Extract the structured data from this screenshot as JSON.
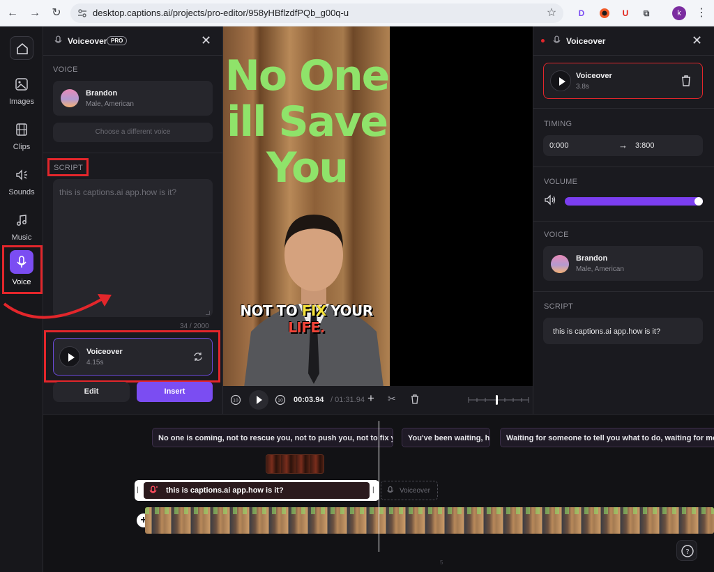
{
  "browser": {
    "url": "desktop.captions.ai/projects/pro-editor/958yHBflzdfPQb_g00q-u",
    "profile_initial": "k"
  },
  "rail": {
    "items": [
      {
        "label": "Images"
      },
      {
        "label": "Clips"
      },
      {
        "label": "Sounds"
      },
      {
        "label": "Music"
      },
      {
        "label": "Voice"
      }
    ]
  },
  "left_panel": {
    "title": "Voiceover",
    "badge": "PRO",
    "voice_section": "VOICE",
    "voice_name": "Brandon",
    "voice_desc": "Male, American",
    "choose_voice": "Choose a different voice",
    "script_section": "SCRIPT",
    "script_placeholder": "this is captions.ai app.how is it?",
    "char_count": "34 / 2000",
    "preview_title": "Voiceover",
    "preview_duration": "4.15s",
    "edit_label": "Edit",
    "insert_label": "Insert"
  },
  "video": {
    "headline_1": "No One",
    "headline_2": "ill Save",
    "headline_3": "You",
    "caption_pre": "NOT TO ",
    "caption_hl": "FIX",
    "caption_post": " YOUR",
    "caption_line2": "LIFE."
  },
  "controls": {
    "current_time": "00:03.94",
    "total_time": "/ 01:31.94"
  },
  "right_panel": {
    "title": "Voiceover",
    "clip_title": "Voiceover",
    "clip_duration": "3.8s",
    "timing_section": "TIMING",
    "start": "0:000",
    "end": "3:800",
    "volume_section": "VOLUME",
    "volume_level": 1.0,
    "voice_section": "VOICE",
    "voice_name": "Brandon",
    "voice_desc": "Male, American",
    "script_section": "SCRIPT",
    "script_text": "this is captions.ai app.how is it?"
  },
  "timeline": {
    "captions": [
      "No one is coming, not to rescue you, not to push you, not to fix your",
      "You've been waiting, ha",
      "Waiting for someone to tell you what to do, waiting for mot"
    ],
    "voice_clip": "this is captions.ai app.how is it?",
    "ghost_clip": "Voiceover",
    "ruler_mark": "5"
  },
  "colors": {
    "accent": "#7b4df2",
    "highlight_red": "#e3262b",
    "caption_yellow": "#f5e23a",
    "caption_red": "#f04438",
    "headline_green": "#8fe36a"
  }
}
